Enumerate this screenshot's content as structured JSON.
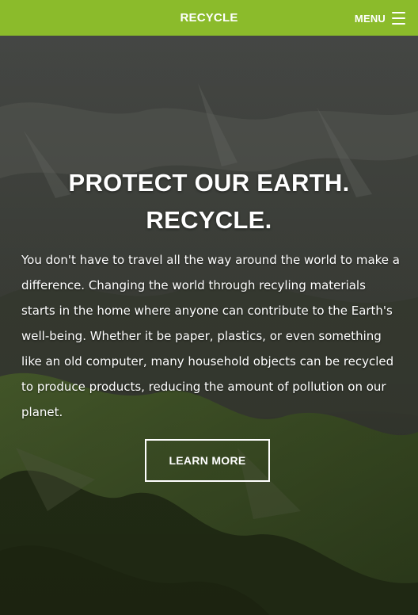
{
  "navbar": {
    "brand": "RECYCLE",
    "menu_label": "MENU",
    "menu_icon": "hamburger-menu-icon",
    "color": "#8bbb2b"
  },
  "hero": {
    "headline_line1": "PROTECT OUR EARTH.",
    "headline_line2": "RECYCLE.",
    "body": "You don't have to travel all the way around the world to make a difference. Changing the world through recyling materials starts in the home where anyone can contribute to the Earth's well-being. Whether it be paper, plastics, or even something like an old computer, many household objects can be recycled to produce products, reducing the amount of pollution on our planet.",
    "cta_label": "LEARN MORE",
    "background": "mountain-landscape"
  }
}
